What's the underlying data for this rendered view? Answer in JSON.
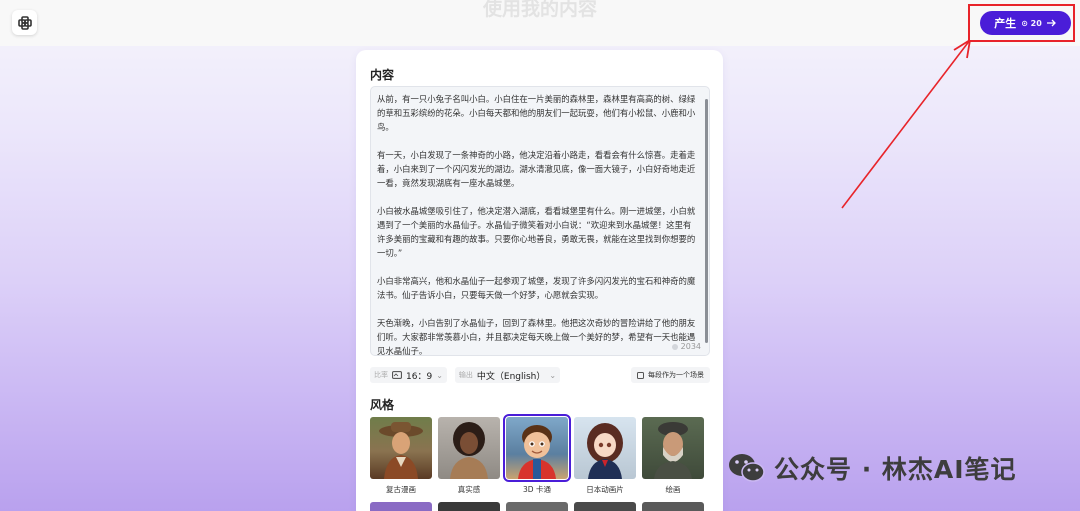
{
  "header": {
    "page_title": "使用我的内容",
    "generate_label": "产生",
    "generate_credit": "⊙ 20"
  },
  "content": {
    "section_title": "内容",
    "paragraphs": [
      "从前，有一只小兔子名叫小白。小白住在一片美丽的森林里，森林里有高高的树、绿绿的草和五彩缤纷的花朵。小白每天都和他的朋友们一起玩耍，他们有小松鼠、小鹿和小鸟。",
      "有一天，小白发现了一条神奇的小路，他决定沿着小路走，看看会有什么惊喜。走着走着，小白来到了一个闪闪发光的湖边。湖水清澈见底，像一面大镜子，小白好奇地走近一看，竟然发现湖底有一座水晶城堡。",
      "小白被水晶城堡吸引住了，他决定潜入湖底，看看城堡里有什么。刚一进城堡，小白就遇到了一个美丽的水晶仙子。水晶仙子微笑着对小白说：“欢迎来到水晶城堡！这里有许多美丽的宝藏和有趣的故事。只要你心地善良，勇敢无畏，就能在这里找到你想要的一切。”",
      "小白非常高兴，他和水晶仙子一起参观了城堡，发现了许多闪闪发光的宝石和神奇的魔法书。仙子告诉小白，只要每天做一个好梦，心愿就会实现。",
      "天色渐晚，小白告别了水晶仙子，回到了森林里。他把这次奇妙的冒险讲给了他的朋友们听。大家都非常羡慕小白，并且都决定每天晚上做一个美好的梦，希望有一天也能遇见水晶仙子。"
    ],
    "char_count": "2034"
  },
  "options": {
    "ratio_prefix": "比率",
    "ratio_value": "16：9",
    "output_prefix": "输出",
    "output_value": "中文（English）",
    "scene_toggle_label": "每段作为一个场景"
  },
  "style": {
    "section_title": "风格",
    "items": [
      {
        "label": "复古漫画",
        "selected": false
      },
      {
        "label": "真实感",
        "selected": false
      },
      {
        "label": "3D 卡通",
        "selected": true
      },
      {
        "label": "日本动画片",
        "selected": false
      },
      {
        "label": "绘画",
        "selected": false
      }
    ]
  },
  "watermark": {
    "text": "公众号 · 林杰AI笔记"
  },
  "colors": {
    "accent": "#4a1dd8",
    "annotation_red": "#e8242a"
  }
}
